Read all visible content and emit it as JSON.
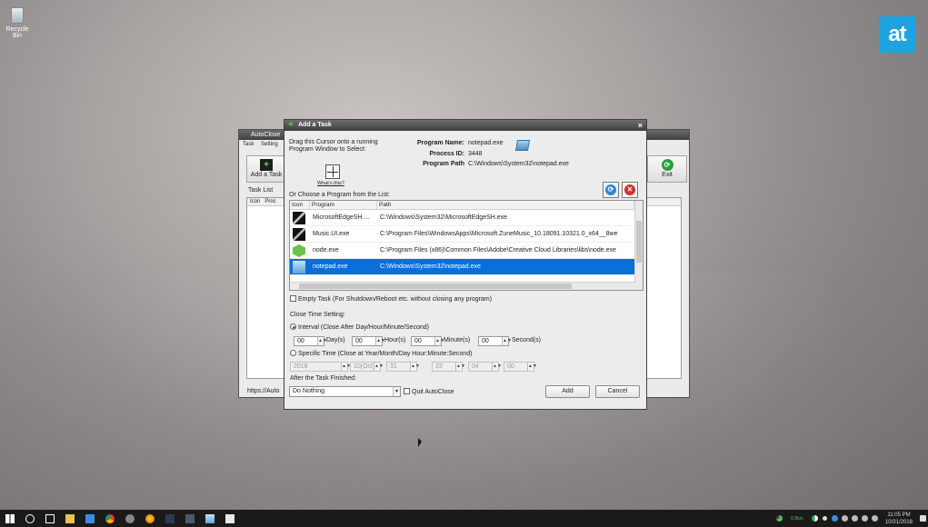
{
  "desktop": {
    "recycle_label": "Recycle Bin",
    "brand_logo": "at"
  },
  "bg_window": {
    "title": "AutoClose",
    "menu": [
      "Task",
      "Setting"
    ],
    "add_task_label": "Add a Task",
    "exit_label": "Exit",
    "task_list_label": "Task List",
    "columns": [
      "Icon",
      "Proc"
    ],
    "link": "https://Auto"
  },
  "dialog": {
    "title": "Add a Task",
    "drag_text_1": "Drag this Cursor onto a running",
    "drag_text_2": "Program Window to Select:",
    "whats_this": "What's this?",
    "program_name_label": "Program Name:",
    "program_name": "notepad.exe",
    "process_id_label": "Process ID:",
    "process_id": "3448",
    "program_path_label": "Program Path",
    "program_path": "C:\\Windows\\System32\\notepad.exe",
    "choose_label": "Or Choose a Program from the List:",
    "columns": {
      "icon": "Icon",
      "program": "Program",
      "path": "Path"
    },
    "programs": [
      {
        "name": "MicrosoftEdgeSH....",
        "path": "C:\\Windows\\System32\\MicrosoftEdgeSH.exe",
        "icon": "edge-icon"
      },
      {
        "name": "Music.UI.exe",
        "path": "C:\\Program Files\\WindowsApps\\Microsoft.ZuneMusic_10.18091.10321.0_x64__8we",
        "icon": "music-icon"
      },
      {
        "name": "node.exe",
        "path": "C:\\Program Files (x86)\\Common Files\\Adobe\\Creative Cloud Libraries\\libs\\node.exe",
        "icon": "node-icon"
      },
      {
        "name": "notepad.exe",
        "path": "C:\\Windows\\System32\\notepad.exe",
        "icon": "notepad-icon",
        "selected": true
      }
    ],
    "empty_task_label": "Empty Task (For Shutdown/Reboot etc. without closing any program)",
    "close_time_label": "Close Time Setting:",
    "interval_label": "Interval (Close After Day/Hour/Minute/Second)",
    "interval": {
      "day": "00",
      "day_unit": "Day(s)",
      "hour": "00",
      "hour_unit": "Hour(s)",
      "minute": "00",
      "minute_unit": "Minute(s)",
      "second": "00",
      "second_unit": "Second(s)"
    },
    "specific_label": "Specific Time (Close at Year/Month/Day Hour:Minute:Second)",
    "specific": {
      "year": "2018",
      "month": "10(Oct)",
      "day": "31",
      "hour": "23",
      "minute": "04",
      "second": "00"
    },
    "after_label": "After the Task Finished:",
    "after_value": "Do Nothing",
    "quit_label": "Quit AutoClose",
    "add_button": "Add",
    "cancel_button": "Cancel"
  },
  "taskbar": {
    "net_rate": "0.0k/s",
    "time": "11:05 PM",
    "date": "10/31/2018"
  }
}
